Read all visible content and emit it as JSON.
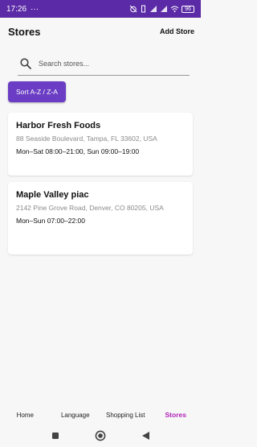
{
  "status_bar": {
    "time": "17:26",
    "more": "···",
    "battery": "96"
  },
  "header": {
    "title": "Stores",
    "add_store_label": "Add Store"
  },
  "search": {
    "placeholder": "Search stores..."
  },
  "sort_button": {
    "label": "Sort A-Z / Z-A"
  },
  "stores": [
    {
      "name": "Harbor Fresh Foods",
      "address": "88 Seaside Boulevard, Tampa, FL 33602, USA",
      "hours": "Mon–Sat 08:00–21:00, Sun 09:00–19:00"
    },
    {
      "name": "Maple Valley piac",
      "address": "2142 Pine Grove Road, Denver, CO 80205, USA",
      "hours": "Mon–Sun 07:00–22:00"
    }
  ],
  "bottom_nav": {
    "items": [
      {
        "label": "Home"
      },
      {
        "label": "Language"
      },
      {
        "label": "Shopping List"
      },
      {
        "label": "Stores"
      }
    ],
    "active_index": 3
  },
  "colors": {
    "status_bar": "#5b2aa6",
    "accent_button": "#6a3dc4",
    "active_nav": "#b023b6",
    "background": "#f7f7f8"
  },
  "icons": {
    "search": "search-icon",
    "system_recents": "square-icon",
    "system_home": "circle-icon",
    "system_back": "triangle-back-icon"
  }
}
